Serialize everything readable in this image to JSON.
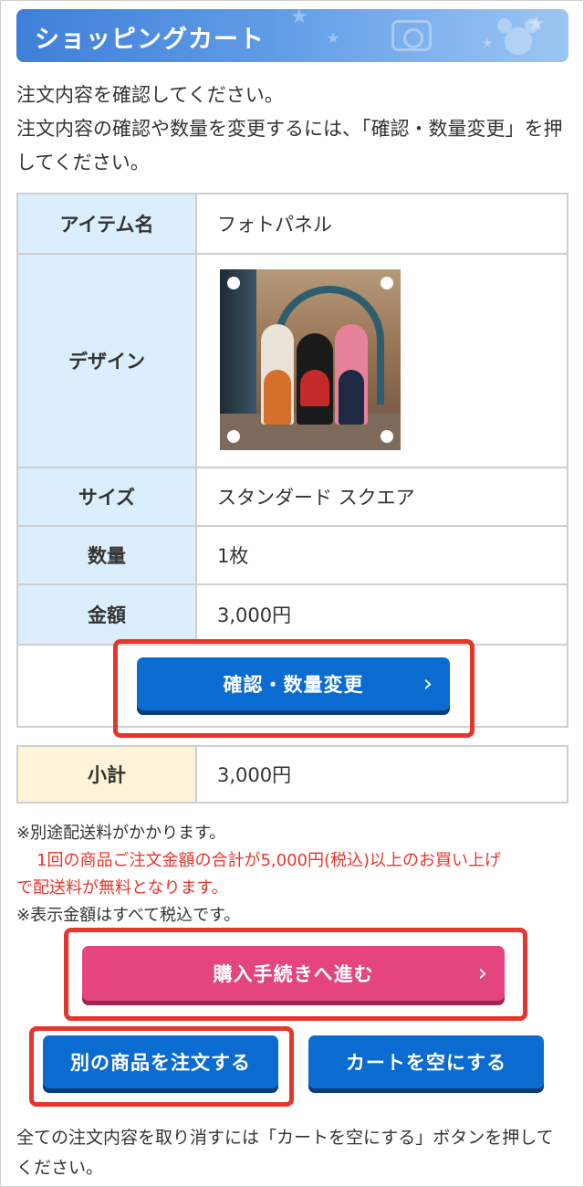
{
  "header": {
    "title": "ショッピングカート"
  },
  "intro": {
    "line1": "注文内容を確認してください。",
    "line2": "注文内容の確認や数量を変更するには、「確認・数量変更」を押してください。"
  },
  "item_table": {
    "rows": [
      {
        "label": "アイテム名",
        "value": "フォトパネル"
      },
      {
        "label": "デザイン",
        "value": ""
      },
      {
        "label": "サイズ",
        "value": "スタンダード スクエア"
      },
      {
        "label": "数量",
        "value": "1枚"
      },
      {
        "label": "金額",
        "value": "3,000円"
      }
    ]
  },
  "buttons": {
    "confirm_quantity": "確認・数量変更",
    "checkout": "購入手続きへ進む",
    "order_other": "別の商品を注文する",
    "empty_cart": "カートを空にする",
    "chevron": "›"
  },
  "subtotal": {
    "label": "小計",
    "value": "3,000円"
  },
  "notes": {
    "shipping": "※別途配送料がかかります。",
    "free_shipping_1": "1回の商品ご注文金額の合計が5,000円(税込)以上のお買い上げ",
    "free_shipping_2": "で配送料が無料となります。",
    "tax": "※表示金額はすべて税込です。"
  },
  "footer": {
    "text": "全ての注文内容を取り消すには「カートを空にする」ボタンを押してください。"
  },
  "colors": {
    "accent_blue": "#0a6bd1",
    "accent_pink": "#e4457e",
    "highlight_red": "#e8352c"
  }
}
